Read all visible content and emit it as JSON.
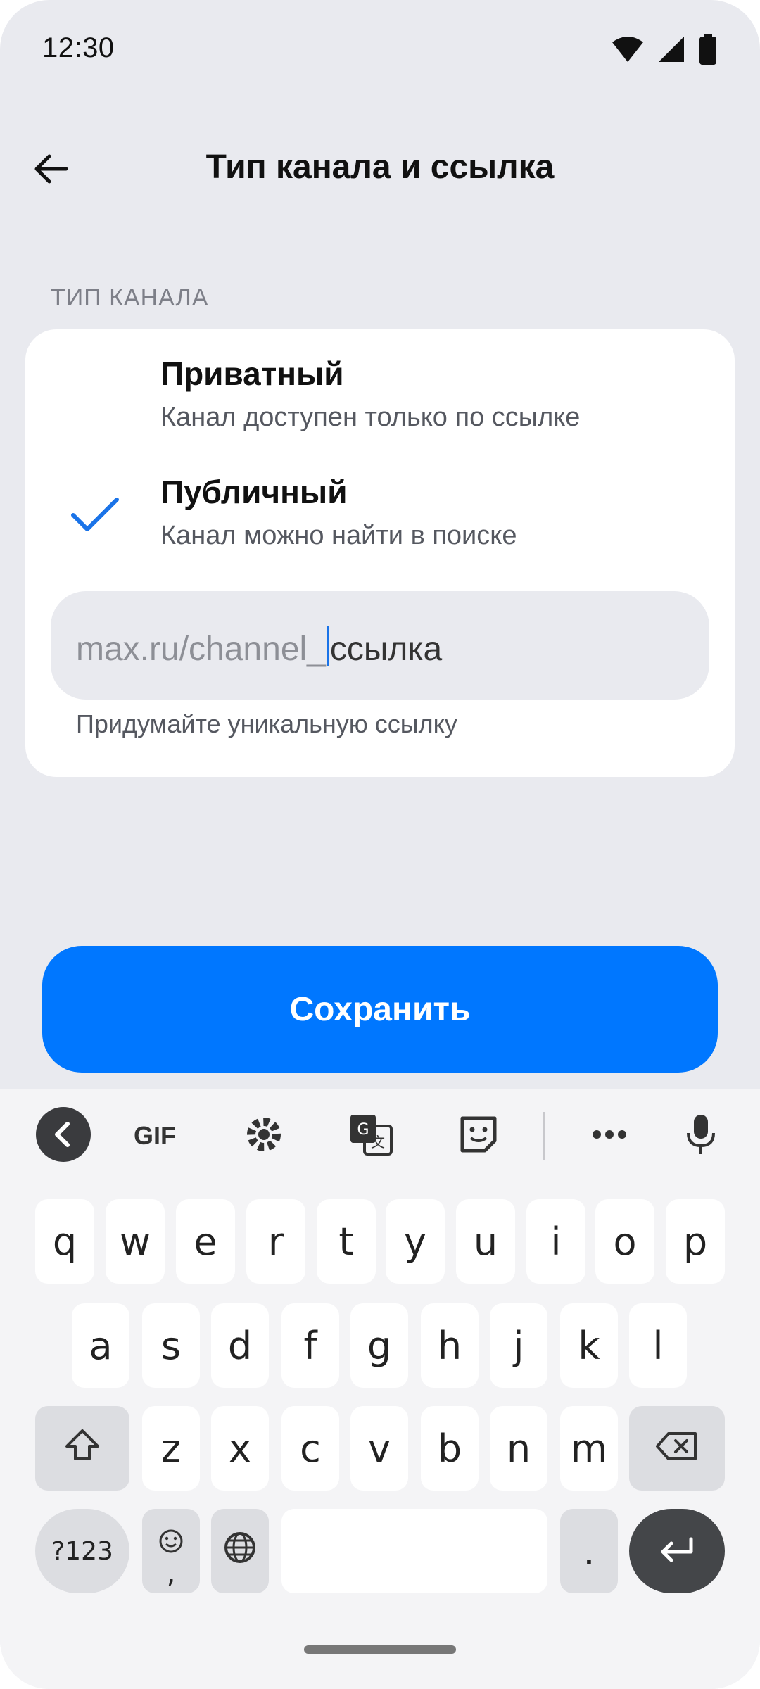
{
  "status_bar": {
    "time": "12:30",
    "icons": [
      "wifi-icon",
      "cell-signal-icon",
      "battery-icon"
    ]
  },
  "header": {
    "title": "Тип канала и ссылка",
    "back_icon": "arrow-left-icon"
  },
  "section": {
    "label": "ТИП КАНАЛА"
  },
  "options": [
    {
      "title": "Приватный",
      "subtitle": "Канал доступен только по ссылке",
      "selected": false
    },
    {
      "title": "Публичный",
      "subtitle": "Канал можно найти в поиске",
      "selected": true
    }
  ],
  "link_field": {
    "prefix": "max.ru/channel_",
    "value": "ссылка",
    "hint": "Придумайте уникальную ссылку"
  },
  "save_button": {
    "label": "Сохранить"
  },
  "keyboard": {
    "toolbar": [
      "collapse-icon",
      "gif-label",
      "settings-icon",
      "translate-icon",
      "sticker-icon",
      "more-icon",
      "mic-icon"
    ],
    "gif_label": "GIF",
    "row1": [
      "q",
      "w",
      "e",
      "r",
      "t",
      "y",
      "u",
      "i",
      "o",
      "p"
    ],
    "row2": [
      "a",
      "s",
      "d",
      "f",
      "g",
      "h",
      "j",
      "k",
      "l"
    ],
    "row3": [
      "z",
      "x",
      "c",
      "v",
      "b",
      "n",
      "m"
    ],
    "symbols_label": "?123",
    "emoji_comma_label": ",",
    "period_label": "."
  },
  "colors": {
    "accent": "#0077ff",
    "background": "#e9eaef",
    "card": "#ffffff",
    "check": "#1a73e8"
  }
}
